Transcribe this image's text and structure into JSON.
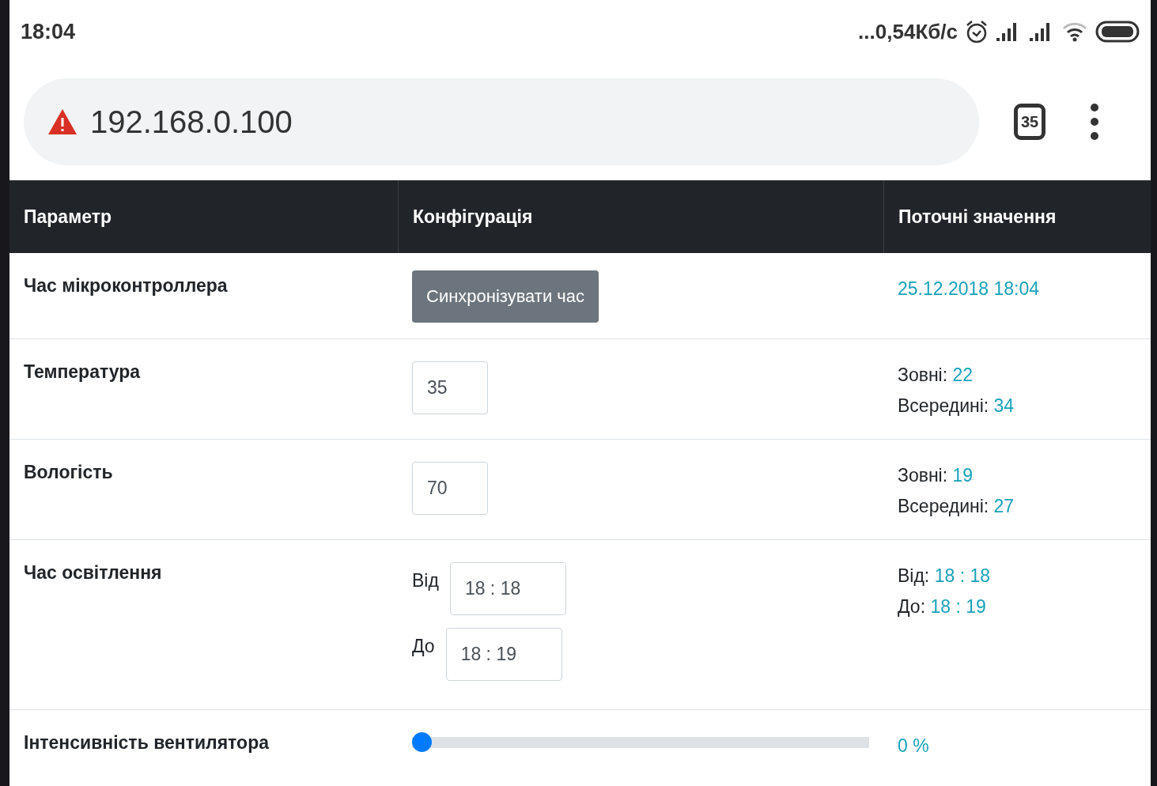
{
  "status_bar": {
    "time": "18:04",
    "network_speed": "...0,54Кб/с"
  },
  "browser": {
    "url": "192.168.0.100",
    "tab_count": "35"
  },
  "table": {
    "columns": [
      "Параметр",
      "Конфігурація",
      "Поточні значення"
    ],
    "rows": [
      {
        "parameter": "Час мікроконтроллера",
        "config": {
          "kind": "button",
          "label": "Синхронізувати час"
        },
        "current": [
          {
            "value": "25.12.2018 18:04"
          }
        ]
      },
      {
        "parameter": "Температура",
        "config": {
          "kind": "number",
          "value": "35"
        },
        "current": [
          {
            "label": "Зовні:",
            "value": "22"
          },
          {
            "label": "Всередині:",
            "value": "34"
          }
        ]
      },
      {
        "parameter": "Вологість",
        "config": {
          "kind": "number",
          "value": "70"
        },
        "current": [
          {
            "label": "Зовні:",
            "value": "19"
          },
          {
            "label": "Всередині:",
            "value": "27"
          }
        ]
      },
      {
        "parameter": "Час освітлення",
        "config": {
          "kind": "time_range",
          "fields": [
            {
              "label": "Від",
              "value": "18 : 18"
            },
            {
              "label": "До",
              "value": "18 : 19"
            }
          ]
        },
        "current": [
          {
            "label": "Від:",
            "value": "18 : 18"
          },
          {
            "label": "До:",
            "value": "18 : 19"
          }
        ]
      },
      {
        "parameter": "Інтенсивність вентилятора",
        "config": {
          "kind": "slider",
          "level": 0
        },
        "current": [
          {
            "value": "0 %"
          }
        ]
      }
    ]
  }
}
